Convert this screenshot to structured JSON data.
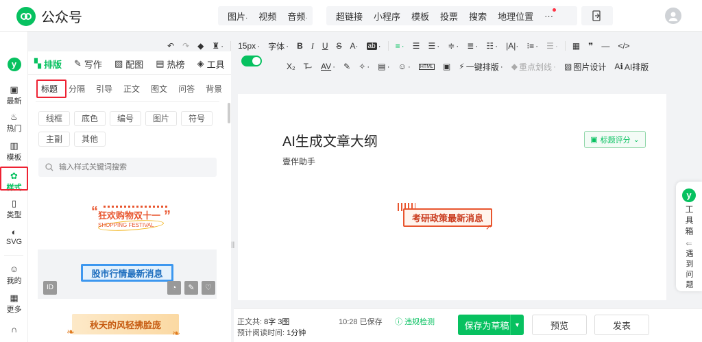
{
  "app": {
    "name": "公众号"
  },
  "top_nav": {
    "group1": [
      "图片",
      "视频",
      "音频"
    ],
    "group2": [
      "超链接",
      "小程序",
      "模板",
      "投票",
      "搜索",
      "地理位置"
    ],
    "more": "···"
  },
  "rail": [
    {
      "icon": "y-logo",
      "label": ""
    },
    {
      "icon": "comment-icon",
      "label": "最新"
    },
    {
      "icon": "flame-icon",
      "label": "热门"
    },
    {
      "icon": "template-icon",
      "label": "模板"
    },
    {
      "icon": "style-icon",
      "label": "样式"
    },
    {
      "icon": "type-icon",
      "label": "类型"
    },
    {
      "icon": "svg-icon",
      "label": "SVG"
    },
    {
      "icon": "user-icon",
      "label": "我的"
    },
    {
      "icon": "grid-icon",
      "label": "更多"
    },
    {
      "icon": "headset-icon",
      "label": ""
    }
  ],
  "panel_tabs": [
    {
      "icon": "layout-icon",
      "label": "排版"
    },
    {
      "icon": "pen-icon",
      "label": "写作"
    },
    {
      "icon": "image-icon",
      "label": "配图"
    },
    {
      "icon": "hot-icon",
      "label": "热榜"
    },
    {
      "icon": "cube-icon",
      "label": "工具"
    }
  ],
  "subtabs": [
    "标题",
    "分隔",
    "引导",
    "正文",
    "图文",
    "问答",
    "背景"
  ],
  "chips": [
    "线框",
    "底色",
    "编号",
    "图片",
    "符号",
    "主副",
    "其他"
  ],
  "search": {
    "placeholder": "输入样式关键词搜索"
  },
  "cards": [
    {
      "title": "狂欢购物双十一",
      "subtitle": "SHOPPING FESTIVAL"
    },
    {
      "title": "股市行情最新消息",
      "badge": "ID"
    },
    {
      "title": "秋天的风轻拂脸庞"
    }
  ],
  "toolbar1": {
    "font_size": "15px",
    "font": "字体"
  },
  "toolbar2": {
    "one_click": "一键排版",
    "highlight": "重点划线",
    "image_design": "图片设计",
    "ai_layout": "AI排版"
  },
  "document": {
    "title": "AI生成文章大纲",
    "author": "壹伴助手",
    "score_button": "标题评分",
    "inserted_heading": "考研政策最新消息"
  },
  "status": {
    "total_label": "正文共:",
    "total_value": "8字 3图",
    "read_label": "预计阅读时间:",
    "read_value": "1分钟",
    "saved": "10:28 已保存",
    "violation": "违规检测"
  },
  "buttons": {
    "save_draft": "保存为草稿",
    "preview": "预览",
    "publish": "发表"
  },
  "side_float": {
    "label1": "工具箱",
    "label2": "遇到问题"
  },
  "colors": {
    "brand_green": "#07c160",
    "highlight_red": "#e23",
    "accent_orange": "#e8552e"
  }
}
